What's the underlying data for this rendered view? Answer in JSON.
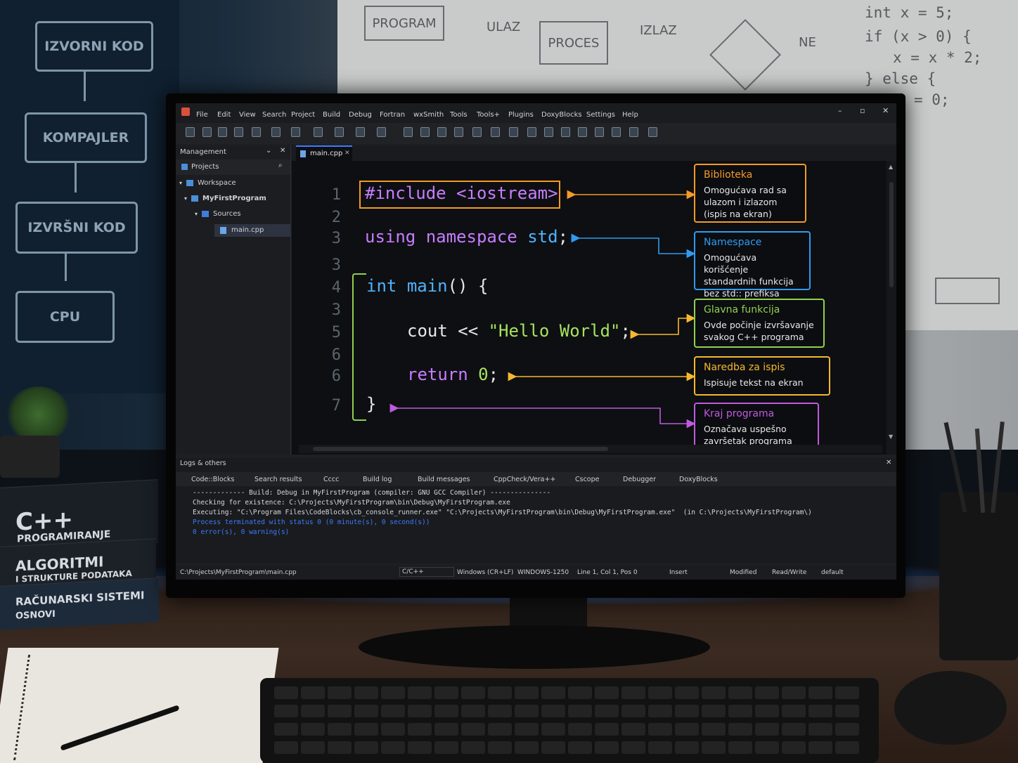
{
  "scene": {
    "blackboard_boxes": [
      "IZVORNI KOD",
      "KOMPAJLER",
      "IZVRŠNI KOD",
      "CPU"
    ],
    "whiteboard": {
      "boxes": [
        "PROGRAM",
        "PROCES"
      ],
      "labels": [
        "ULAZ",
        "IZLAZ",
        "NE"
      ],
      "code_lines": [
        "int x = 5;",
        "if (x > 0) {",
        "x = x * 2;",
        "} else {",
        "= 0;"
      ]
    },
    "books": [
      {
        "title": "C++",
        "subtitle": "PROGRAMIRANJE"
      },
      {
        "title": "ALGORITMI",
        "subtitle": "I STRUKTURE PODATAKA"
      },
      {
        "title": "RAČUNARSKI SISTEMI",
        "subtitle": "OSNOVI"
      }
    ]
  },
  "ide": {
    "menu": [
      "File",
      "Edit",
      "View",
      "Search",
      "Project",
      "Build",
      "Debug",
      "Fortran",
      "wxSmith",
      "Tools",
      "Tools+",
      "Plugins",
      "DoxyBlocks",
      "Settings",
      "Help"
    ],
    "window_controls": {
      "minimize": "–",
      "maximize": "▫",
      "close": "✕"
    },
    "management": {
      "title": "Management",
      "tab": "Projects",
      "tree": [
        "Workspace",
        "MyFirstProgram",
        "Sources",
        "main.cpp"
      ]
    },
    "editor_tab": "main.cpp",
    "code": {
      "line_numbers": [
        "1",
        "2",
        "3",
        "3",
        "4",
        "3",
        "5",
        "6",
        "6",
        "7"
      ],
      "include": "#include <iostream>",
      "using_kw": "using namespace",
      "using_std": "std",
      "using_semi": ";",
      "int_kw": "int",
      "main_name": "main",
      "main_rest": "() {",
      "cout_a": "cout <<",
      "cout_str": "\"Hello World\"",
      "cout_semi": ";",
      "return_kw": "return",
      "return_val": "0",
      "return_semi": ";",
      "close_brace": "}"
    },
    "callouts": [
      {
        "title": "Biblioteka",
        "desc": "Omogućava rad sa ulazom i izlazom (ispis na ekran)",
        "color": "#f39a28"
      },
      {
        "title": "Namespace",
        "desc": "Omogućava korišćenje standardnih funkcija bez std:: prefiksa",
        "color": "#2f9bf0"
      },
      {
        "title": "Glavna funkcija",
        "desc": "Ovde počinje izvršavanje svakog C++ programa",
        "color": "#8fd14f"
      },
      {
        "title": "Naredba za ispis",
        "desc": "Ispisuje tekst na ekran",
        "color": "#f5b82e"
      },
      {
        "title": "Kraj programa",
        "desc": "Označava uspešno završetak programa",
        "color": "#c05ae0"
      }
    ],
    "logs": {
      "title": "Logs & others",
      "tabs": [
        "Code::Blocks",
        "Search results",
        "Cccc",
        "Build log",
        "Build messages",
        "CppCheck/Vera++",
        "Cscope",
        "Debugger",
        "DoxyBlocks"
      ],
      "lines": [
        {
          "text": "------------- Build: Debug in MyFirstProgram (compiler: GNU GCC Compiler) ---------------",
          "color": "#d6d8dc"
        },
        {
          "text": "Checking for existence: C:\\Projects\\MyFirstProgram\\bin\\Debug\\MyFirstProgram.exe",
          "color": "#d6d8dc"
        },
        {
          "text": "Executing: \"C:\\Program Files\\CodeBlocks\\cb_console_runner.exe\" \"C:\\Projects\\MyFirstProgram\\bin\\Debug\\MyFirstProgram.exe\"  (in C:\\Projects\\MyFirstProgram\\)",
          "color": "#d6d8dc"
        },
        {
          "text": "Process terminated with status 0 (0 minute(s), 0 second(s))",
          "color": "#3b7bff"
        },
        {
          "text": "0 error(s), 0 warning(s)",
          "color": "#3b7bff"
        }
      ]
    },
    "status": {
      "path": "C:\\Projects\\MyFirstProgram\\main.cpp",
      "lang": "C/C++",
      "eol": "Windows (CR+LF)",
      "encoding": "WINDOWS-1250",
      "position": "Line 1, Col 1, Pos 0",
      "mode": "Insert",
      "modified": "Modified",
      "access": "Read/Write",
      "profile": "default"
    }
  }
}
